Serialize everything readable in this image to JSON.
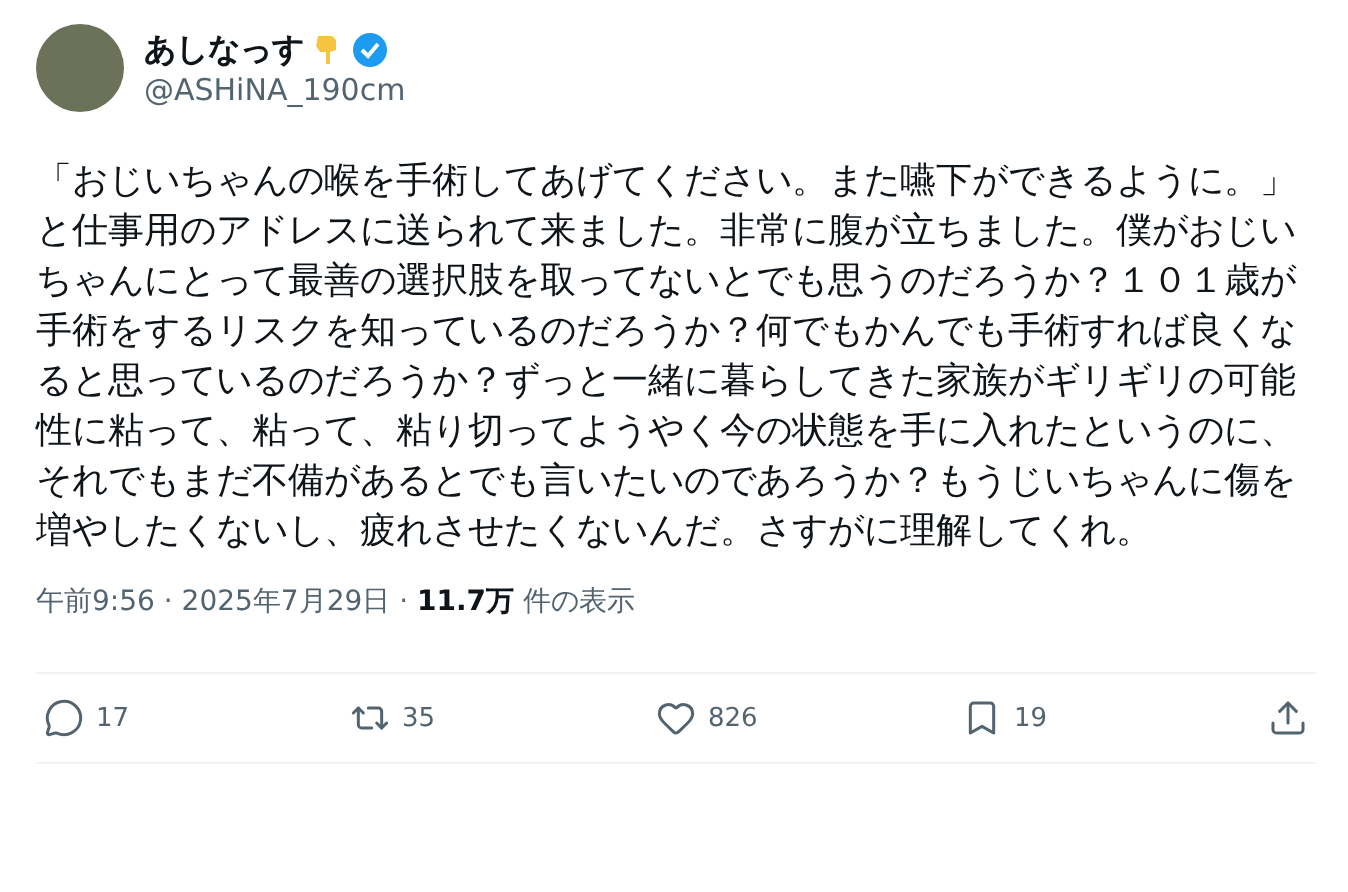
{
  "author": {
    "name": "あしなっす",
    "handle": "@ASHiNA_190cm",
    "verified": true
  },
  "body": "「おじいちゃんの喉を手術してあげてください。また嚥下ができるように。」と仕事用のアドレスに送られて来ました。非常に腹が立ちました。僕がおじいちゃんにとって最善の選択肢を取ってないとでも思うのだろうか？１０１歳が手術をするリスクを知っているのだろうか？何でもかんでも手術すれば良くなると思っているのだろうか？ずっと一緒に暮らしてきた家族がギリギリの可能性に粘って、粘って、粘り切ってようやく今の状態を手に入れたというのに、それでもまだ不備があるとでも言いたいのであろうか？もうじいちゃんに傷を増やしたくないし、疲れさせたくないんだ。さすがに理解してくれ。",
  "meta": "午前9:56 · 2025年7月29日 · **11.7万** 件の表示",
  "actions": [
    {
      "kind": "reply",
      "count": "17"
    },
    {
      "kind": "repost",
      "count": "35"
    },
    {
      "kind": "like",
      "count": "826"
    },
    {
      "kind": "bookmark",
      "count": "19"
    },
    {
      "kind": "share"
    }
  ]
}
